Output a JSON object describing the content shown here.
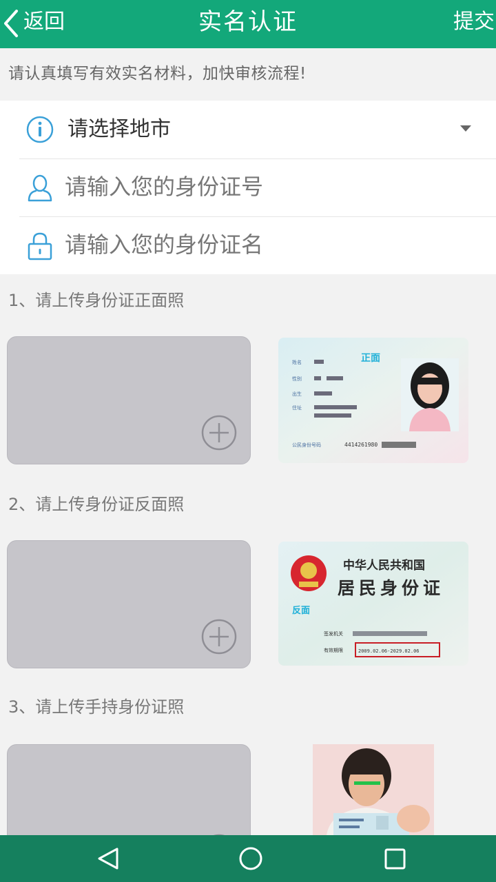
{
  "header": {
    "back_label": "返回",
    "title": "实名认证",
    "submit_label": "提交"
  },
  "notice": "请认真填写有效实名材料，加快审核流程!",
  "form": {
    "city_select": "请选择地市",
    "id_number_placeholder": "请输入您的身份证号",
    "id_name_placeholder": "请输入您的身份证名"
  },
  "uploads": [
    {
      "label": "1、请上传身份证正面照",
      "sample_text": "正面",
      "sample_lines": [
        "姓名",
        "性别",
        "出生",
        "住址",
        "公民身份号码"
      ],
      "sample_number": "4414261980"
    },
    {
      "label": "2、请上传身份证反面照",
      "sample_title_1": "中华人民共和国",
      "sample_title_2": "居民身份证",
      "sample_text": "反面",
      "sample_lines": [
        "签发机关",
        "有效期限"
      ],
      "sample_validity": "2009.02.06-2029.02.06"
    },
    {
      "label": "3、请上传手持身份证照"
    }
  ],
  "colors": {
    "header": "#13a87a",
    "navbar": "#15805e",
    "upload_box": "#c6c5ca",
    "icon_blue": "#3aa0d8"
  },
  "icons": {
    "back": "chevron-left-icon",
    "info": "info-icon",
    "user": "user-icon",
    "lock": "lock-icon",
    "plus": "plus-circle-icon",
    "nav_back": "triangle-back-icon",
    "nav_home": "circle-home-icon",
    "nav_recent": "square-recent-icon"
  }
}
